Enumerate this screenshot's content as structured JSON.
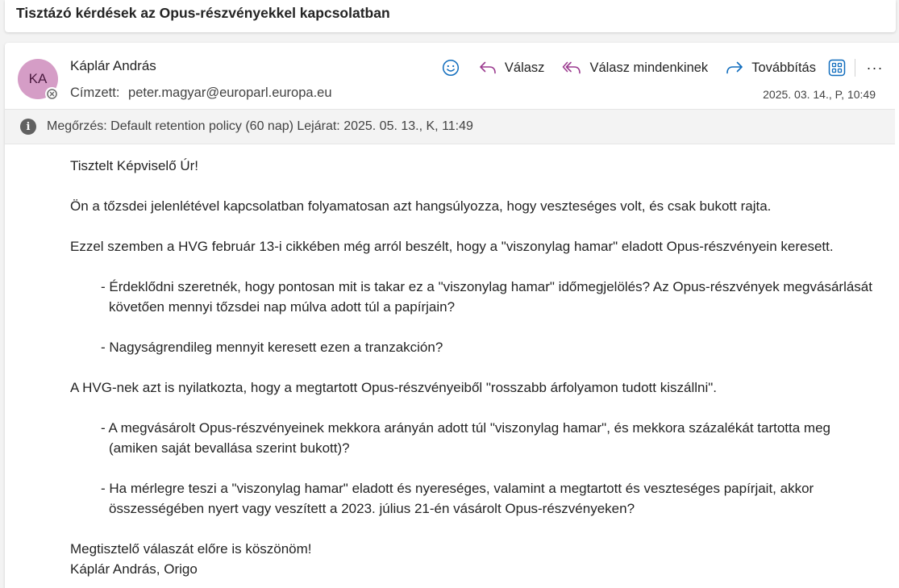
{
  "subject": "Tisztázó kérdések az Opus-részvényekkel kapcsolatban",
  "message": {
    "avatar_initials": "KA",
    "sender_name": "Káplár András",
    "to_label": "Címzett:",
    "to_address": "peter.magyar@europarl.europa.eu",
    "date": "2025. 03. 14., P, 10:49",
    "actions": {
      "reply": "Válasz",
      "reply_all": "Válasz mindenkinek",
      "forward": "Továbbítás",
      "more": "···"
    },
    "retention": "Megőrzés: Default retention policy (60 nap) Lejárat: 2025. 05. 13., K, 11:49",
    "body": {
      "greeting": "Tisztelt Képviselő Úr!",
      "p1": "Ön a tőzsdei jelenlétével kapcsolatban folyamatosan azt hangsúlyozza, hogy veszteséges volt, és csak bukott rajta.",
      "p2": "Ezzel szemben a HVG február 13-i cikkében még arról beszélt, hogy a \"viszonylag hamar\" eladott Opus-részvényein keresett.",
      "b1": "- Érdeklődni szeretnék, hogy pontosan mit is takar ez a \"viszonylag hamar\" időmegjelölés? Az Opus-részvények megvásárlását követően mennyi tőzsdei nap múlva adott túl a papírjain?",
      "b2": "- Nagyságrendileg mennyit keresett ezen a tranzakción?",
      "p3": "A HVG-nek azt is nyilatkozta, hogy a megtartott Opus-részvényeiből \"rosszabb árfolyamon tudott kiszállni\".",
      "b3": "- A megvásárolt Opus-részvényeinek mekkora arányán adott túl \"viszonylag hamar\", és mekkora százalékát tartotta meg (amiken saját bevallása szerint bukott)?",
      "b4": "- Ha mérlegre teszi a \"viszonylag hamar\" eladott és nyereséges, valamint a megtartott és veszteséges papírjait, akkor összességében nyert vagy veszített a 2023. július 21-én vásárolt Opus-részvényeken?",
      "closing": "Megtisztelő válaszát előre is köszönöm!",
      "signature": "Káplár András, Origo"
    }
  },
  "colors": {
    "accent": "#0f6cbd",
    "reply_icon": "#9b3a8f",
    "avatar_bg": "#d59dc6"
  }
}
